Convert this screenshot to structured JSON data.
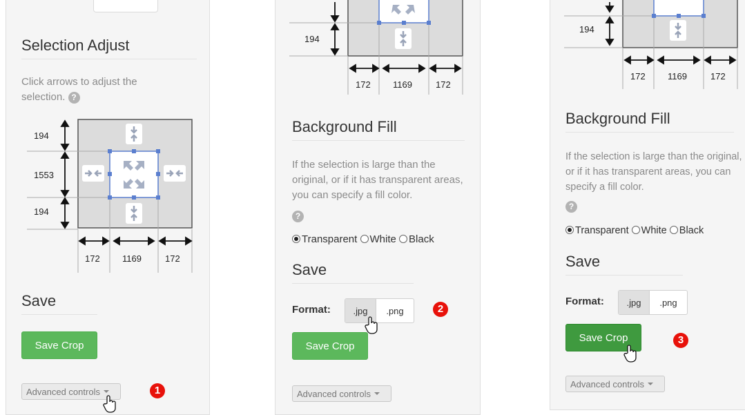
{
  "colors": {
    "accent_green": "#5cb85c",
    "marker_red": "#e8110a",
    "handle_blue": "#5b7fcf"
  },
  "panel1": {
    "selection_adjust": {
      "title": "Selection Adjust",
      "description": "Click arrows to adjust the selection.",
      "help_icon": "?",
      "top": "194",
      "middle": "1553",
      "bottom": "194",
      "left": "172",
      "center": "1169",
      "right": "172"
    },
    "save": {
      "title": "Save",
      "save_crop_label": "Save Crop"
    },
    "advanced_label": "Advanced controls",
    "marker": "1"
  },
  "panel2": {
    "crop": {
      "bottom": "194",
      "left": "172",
      "center": "1169",
      "right": "172"
    },
    "background_fill": {
      "title": "Background Fill",
      "description": "If the selection is large than the original, or if it has transparent areas, you can specify a fill color.",
      "help_icon": "?",
      "options": [
        "Transparent",
        "White",
        "Black"
      ],
      "selected": "Transparent"
    },
    "save": {
      "title": "Save",
      "format_label": "Format:",
      "jpg_label": ".jpg",
      "png_label": ".png",
      "save_crop_label": "Save Crop"
    },
    "advanced_label": "Advanced controls",
    "marker": "2"
  },
  "panel3": {
    "crop": {
      "bottom": "194",
      "left": "172",
      "center": "1169",
      "right": "172"
    },
    "background_fill": {
      "title": "Background Fill",
      "description": "If the selection is large than the original, or if it has transparent areas, you can specify a fill color.",
      "help_icon": "?",
      "options": [
        "Transparent",
        "White",
        "Black"
      ],
      "selected": "Transparent"
    },
    "save": {
      "title": "Save",
      "format_label": "Format:",
      "jpg_label": ".jpg",
      "png_label": ".png",
      "save_crop_label": "Save Crop"
    },
    "advanced_label": "Advanced controls",
    "marker": "3"
  }
}
